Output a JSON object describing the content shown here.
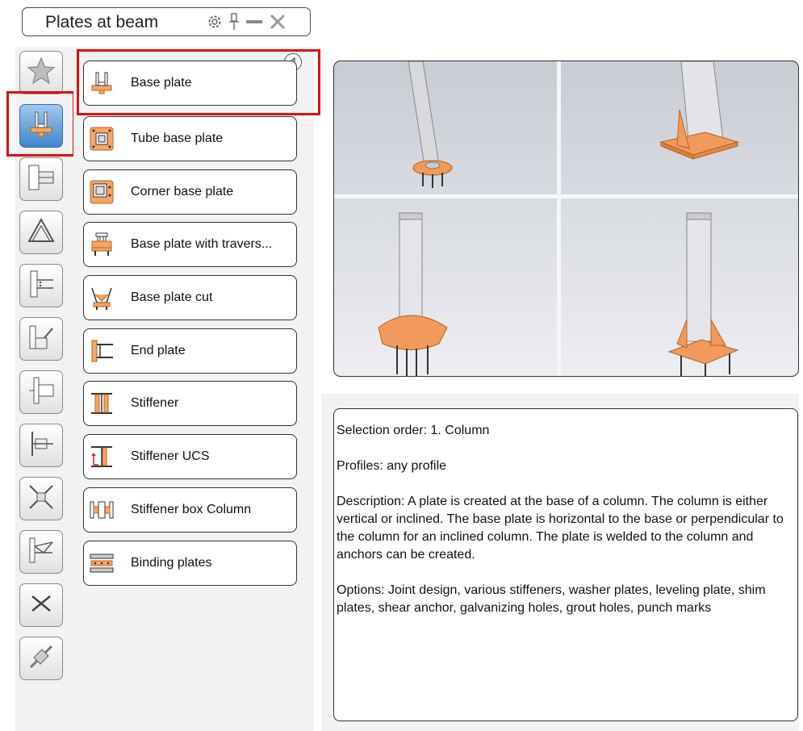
{
  "window": {
    "title": "Plates at beam",
    "icons": [
      "gear-icon",
      "pin-icon",
      "minimize-icon",
      "close-icon"
    ]
  },
  "categories": [
    {
      "name": "favorites",
      "icon": "star-icon",
      "active": false
    },
    {
      "name": "plates-at-beam",
      "icon": "base-plate-icon",
      "active": true
    },
    {
      "name": "beam-end-connections",
      "icon": "beam-connection-icon",
      "active": false
    },
    {
      "name": "frame-joints",
      "icon": "frame-icon",
      "active": false
    },
    {
      "name": "joints-type3",
      "icon": "beam-joint-icon",
      "active": false
    },
    {
      "name": "bracing",
      "icon": "brace-icon",
      "active": false
    },
    {
      "name": "joints-type5",
      "icon": "column-joint-icon",
      "active": false
    },
    {
      "name": "joints-type6",
      "icon": "splice-icon",
      "active": false
    },
    {
      "name": "joints-type7",
      "icon": "cross-brace-icon",
      "active": false
    },
    {
      "name": "joints-type8",
      "icon": "truss-icon",
      "active": false
    },
    {
      "name": "joints-type9",
      "icon": "stairs-icon",
      "active": false
    },
    {
      "name": "joints-type10",
      "icon": "tools-icon",
      "active": false
    }
  ],
  "items": [
    {
      "label": "Base plate",
      "icon": "base-plate-icon"
    },
    {
      "label": "Tube base plate",
      "icon": "tube-base-plate-icon"
    },
    {
      "label": "Corner base plate",
      "icon": "corner-base-plate-icon"
    },
    {
      "label": "Base plate with travers...",
      "icon": "traverse-base-plate-icon"
    },
    {
      "label": "Base plate cut",
      "icon": "base-plate-cut-icon"
    },
    {
      "label": "End plate",
      "icon": "end-plate-icon"
    },
    {
      "label": "Stiffener",
      "icon": "stiffener-icon"
    },
    {
      "label": "Stiffener UCS",
      "icon": "stiffener-ucs-icon"
    },
    {
      "label": "Stiffener box Column",
      "icon": "stiffener-box-column-icon"
    },
    {
      "label": "Binding plates",
      "icon": "binding-plates-icon"
    }
  ],
  "description": {
    "selection_order": "Selection order: 1. Column",
    "profiles": "Profiles: any profile",
    "description": "Description: A plate is created at the base of a column. The column is either vertical or inclined. The base plate is horizontal to the base or perpendicular to the column for an inclined column. The plate is welded to the column and anchors can be created.",
    "options": "Options: Joint design, various stiffeners, washer plates, leveling plate, shim plates, shear anchor, galvanizing holes, grout holes, punch marks"
  },
  "colors": {
    "accent": "#f0a060",
    "plate": "#f29a5c",
    "active_blue": "#4a90d9",
    "highlight": "#e01010"
  }
}
